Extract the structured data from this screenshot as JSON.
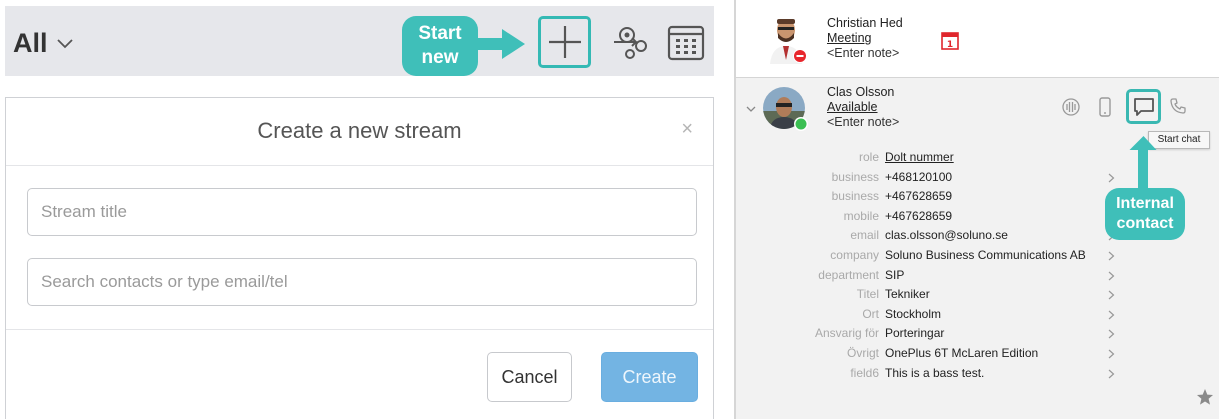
{
  "left": {
    "filter_label": "All",
    "callout_start_line1": "Start",
    "callout_start_line2": "new",
    "dialog": {
      "title": "Create a new stream",
      "close": "×",
      "title_placeholder": "Stream title",
      "contacts_placeholder": "Search contacts or type email/tel",
      "cancel_label": "Cancel",
      "create_label": "Create"
    }
  },
  "right": {
    "contact1": {
      "name": "Christian Hed",
      "status": "Meeting",
      "note": "<Enter note>",
      "calendar_day": "1"
    },
    "contact2": {
      "name": "Clas Olsson",
      "status": "Available",
      "note": "<Enter note>"
    },
    "tooltip": "Start chat",
    "callout_line1": "Internal",
    "callout_line2": "contact",
    "fields": [
      {
        "label": "role",
        "value": "Dolt nummer",
        "link": true,
        "chevron": false
      },
      {
        "label": "business",
        "value": "+468120100",
        "link": false,
        "chevron": true
      },
      {
        "label": "business",
        "value": "+467628659",
        "link": false,
        "chevron": true
      },
      {
        "label": "mobile",
        "value": "+467628659",
        "link": false,
        "chevron": true
      },
      {
        "label": "email",
        "value": "clas.olsson@soluno.se",
        "link": false,
        "chevron": true
      },
      {
        "label": "company",
        "value": "Soluno Business Communications AB",
        "link": false,
        "chevron": true
      },
      {
        "label": "department",
        "value": "SIP",
        "link": false,
        "chevron": true
      },
      {
        "label": "Titel",
        "value": "Tekniker",
        "link": false,
        "chevron": true
      },
      {
        "label": "Ort",
        "value": "Stockholm",
        "link": false,
        "chevron": true
      },
      {
        "label": "Ansvarig för",
        "value": "Porteringar",
        "link": false,
        "chevron": true
      },
      {
        "label": "Övrigt",
        "value": "OnePlus 6T McLaren Edition",
        "link": false,
        "chevron": true
      },
      {
        "label": "field6",
        "value": "This is a bass test.",
        "link": false,
        "chevron": true
      }
    ]
  },
  "colors": {
    "accent_teal": "#3fbfb9",
    "create_blue": "#73b4e3",
    "status_red": "#e8262c",
    "status_green": "#3bbf52"
  },
  "icons": [
    "chevron-down-icon",
    "plus-icon",
    "gear-icon",
    "calendar-grid-icon",
    "close-icon",
    "calendar-day-icon",
    "voicemail-icon",
    "mobile-phone-icon",
    "chat-icon",
    "phone-icon",
    "star-icon"
  ]
}
